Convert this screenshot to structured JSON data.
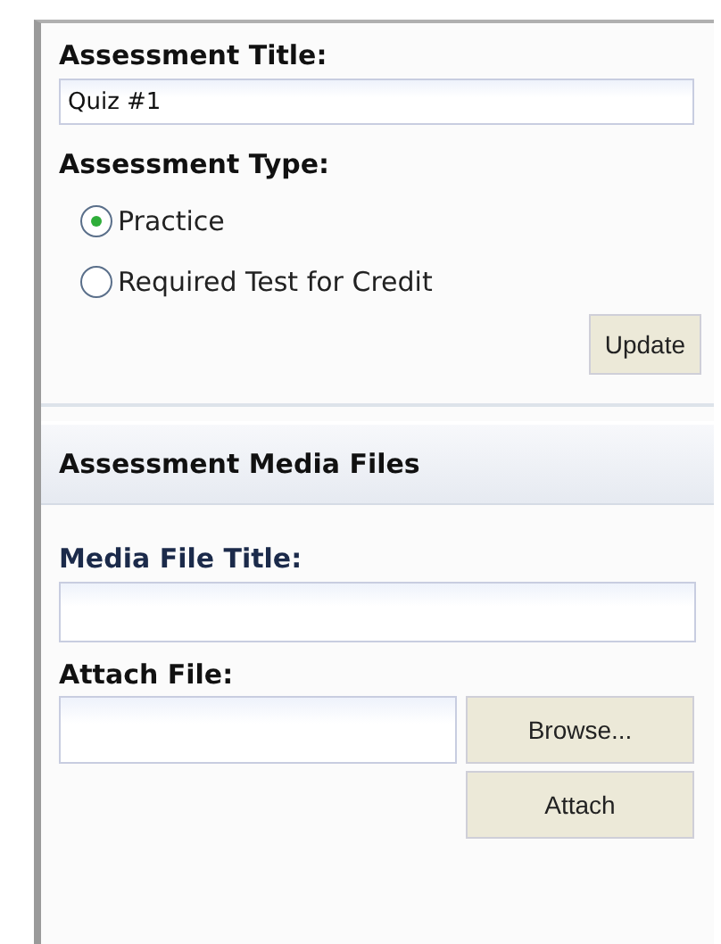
{
  "title_label": "Assessment Title:",
  "title_field": {
    "value": "Quiz #1"
  },
  "type_label": "Assessment Type:",
  "types": [
    {
      "label": "Practice",
      "selected": true
    },
    {
      "label": "Required Test for Credit",
      "selected": false
    }
  ],
  "update_button": "Update",
  "media_section": {
    "heading": "Assessment Media Files",
    "media_title_label": "Media File Title:",
    "attach_label": "Attach File:",
    "browse_button": "Browse...",
    "attach_button": "Attach"
  }
}
